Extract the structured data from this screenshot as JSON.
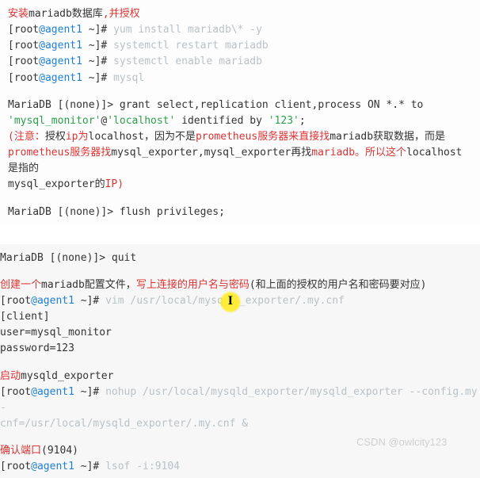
{
  "blk1": {
    "l1": {
      "a": "安装",
      "b": "mariadb数据库",
      "c": ",并授权"
    },
    "l2": {
      "pre": "[root",
      "at": "@agent1",
      "tild": " ~]# ",
      "cmd": "yum install mariadb\\* -y"
    },
    "l3": {
      "pre": "[root",
      "at": "@agent1",
      "tild": " ~]# ",
      "cmd": "systemctl restart mariadb"
    },
    "l4": {
      "pre": "[root",
      "at": "@agent1",
      "tild": " ~]# ",
      "cmd": "systemctl enable mariadb"
    },
    "l5": {
      "pre": "[root",
      "at": "@agent1",
      "tild": " ~]# ",
      "cmd": "mysql"
    },
    "l6a": "MariaDB [(none)]> grant select,replication client,process ON *.* to",
    "l6b_a": "'mysql_monitor'",
    "l6b_b": "@",
    "l6b_c": "'localhost'",
    "l6b_d": " identified by ",
    "l6b_e": "'123'",
    "l6b_f": ";",
    "l7": {
      "a": "(注意：",
      "b": "授权",
      "c": "ip为",
      "d": "localhost，因为不是",
      "e": "prometheus服务器来直接找",
      "f": "mariadb获取数据，而是"
    },
    "l8": {
      "a": "prometheus服务器找",
      "b": "mysql_exporter,mysql_exporter再找",
      "c": "mariadb。所以这个",
      "d": "localhost是指的"
    },
    "l9": {
      "a": "mysql_exporter的",
      "b": "IP)"
    },
    "l10": "MariaDB [(none)]> flush privileges;"
  },
  "blk2": {
    "l1": "MariaDB [(none)]> quit",
    "l2": {
      "a": "创建一个",
      "b": "mariadb配置文件，",
      "c": "写上连接的用户名与密码",
      "d": "(和上面的授权的用户名和密码要对应)"
    },
    "l3": {
      "pre": "[root",
      "at": "@agent1",
      "tild": " ~]# ",
      "cmd1": "vim /usr/local/mysq",
      "cmd2": "_exporter/.my.cnf"
    },
    "l4": "[client]",
    "l5": "user=mysql_monitor",
    "l6": "password=123",
    "l7": {
      "a": "启动",
      "b": "mysqld_exporter"
    },
    "l8": {
      "pre": "[root",
      "at": "@agent1",
      "tild": " ~]# ",
      "cmd": "nohup /usr/local/mysqld_exporter/mysqld_exporter --config.my-"
    },
    "l8b": "cnf=/usr/local/mysqld_exporter/.my.cnf &",
    "l9": {
      "a": "确认端口",
      "b": "(9104)"
    },
    "l10": {
      "pre": "[root",
      "at": "@agent1",
      "tild": " ~]# ",
      "cmd": "lsof -i:9104"
    }
  },
  "caret_glyph": "I",
  "watermark": "CSDN @owlcity123"
}
